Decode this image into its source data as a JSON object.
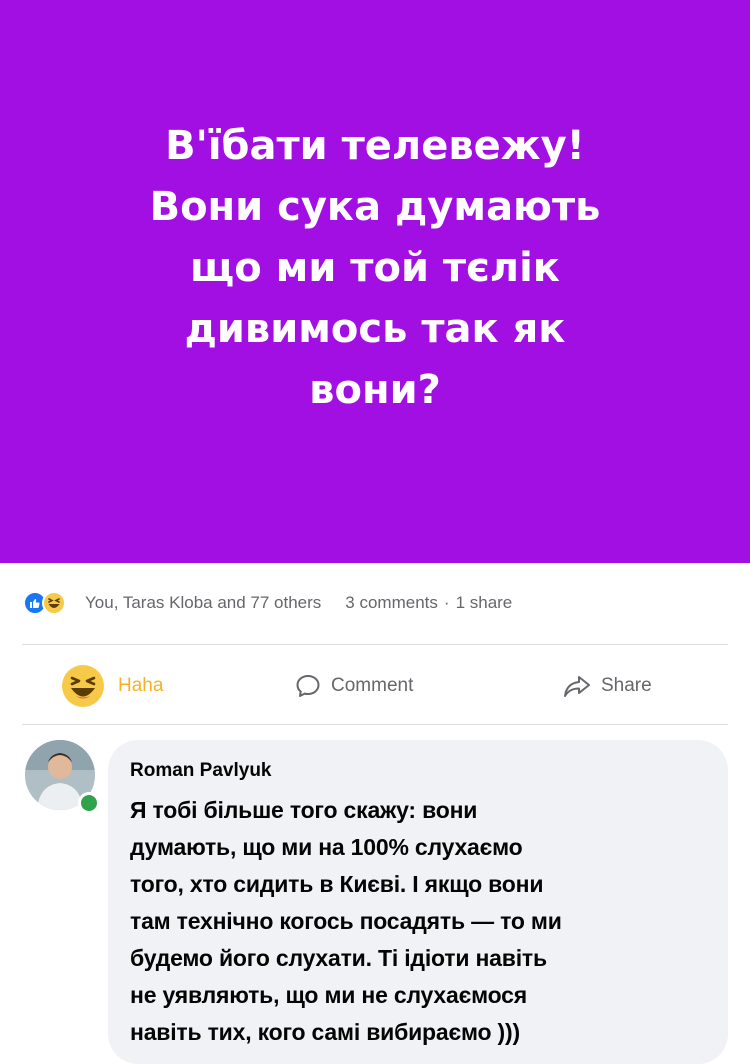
{
  "post": {
    "text": "В'їбати телевежу!\nВони сука думають\nщо ми той тєлік\nдивимось так як\nвони?",
    "background_color": "#a20fe2"
  },
  "reactions": {
    "icons": [
      "like-icon",
      "haha-icon"
    ],
    "names": "You, Taras Kloba and 77 others",
    "comments_count": "3 comments",
    "separator": "·",
    "shares_count": "1 share"
  },
  "actions": {
    "haha_label": "Haha",
    "comment_label": "Comment",
    "share_label": "Share"
  },
  "comment": {
    "author": "Roman Pavlyuk",
    "text": "Я тобі більше того скажу: вони\nдумають, що ми на 100% слухаємо\nтого, хто сидить в Києві. І якщо вони\nтам технічно когось посадять — то ми\nбудемо його слухати. Ті ідіоти навіть\nне уявляють, що ми не слухаємося\nнавіть тих, кого самі вибираємо )))",
    "online_status_color": "#31a24c"
  },
  "colors": {
    "facebook_blue": "#1877f2",
    "haha_yellow": "#f7c948",
    "muted_text": "#65676b"
  }
}
